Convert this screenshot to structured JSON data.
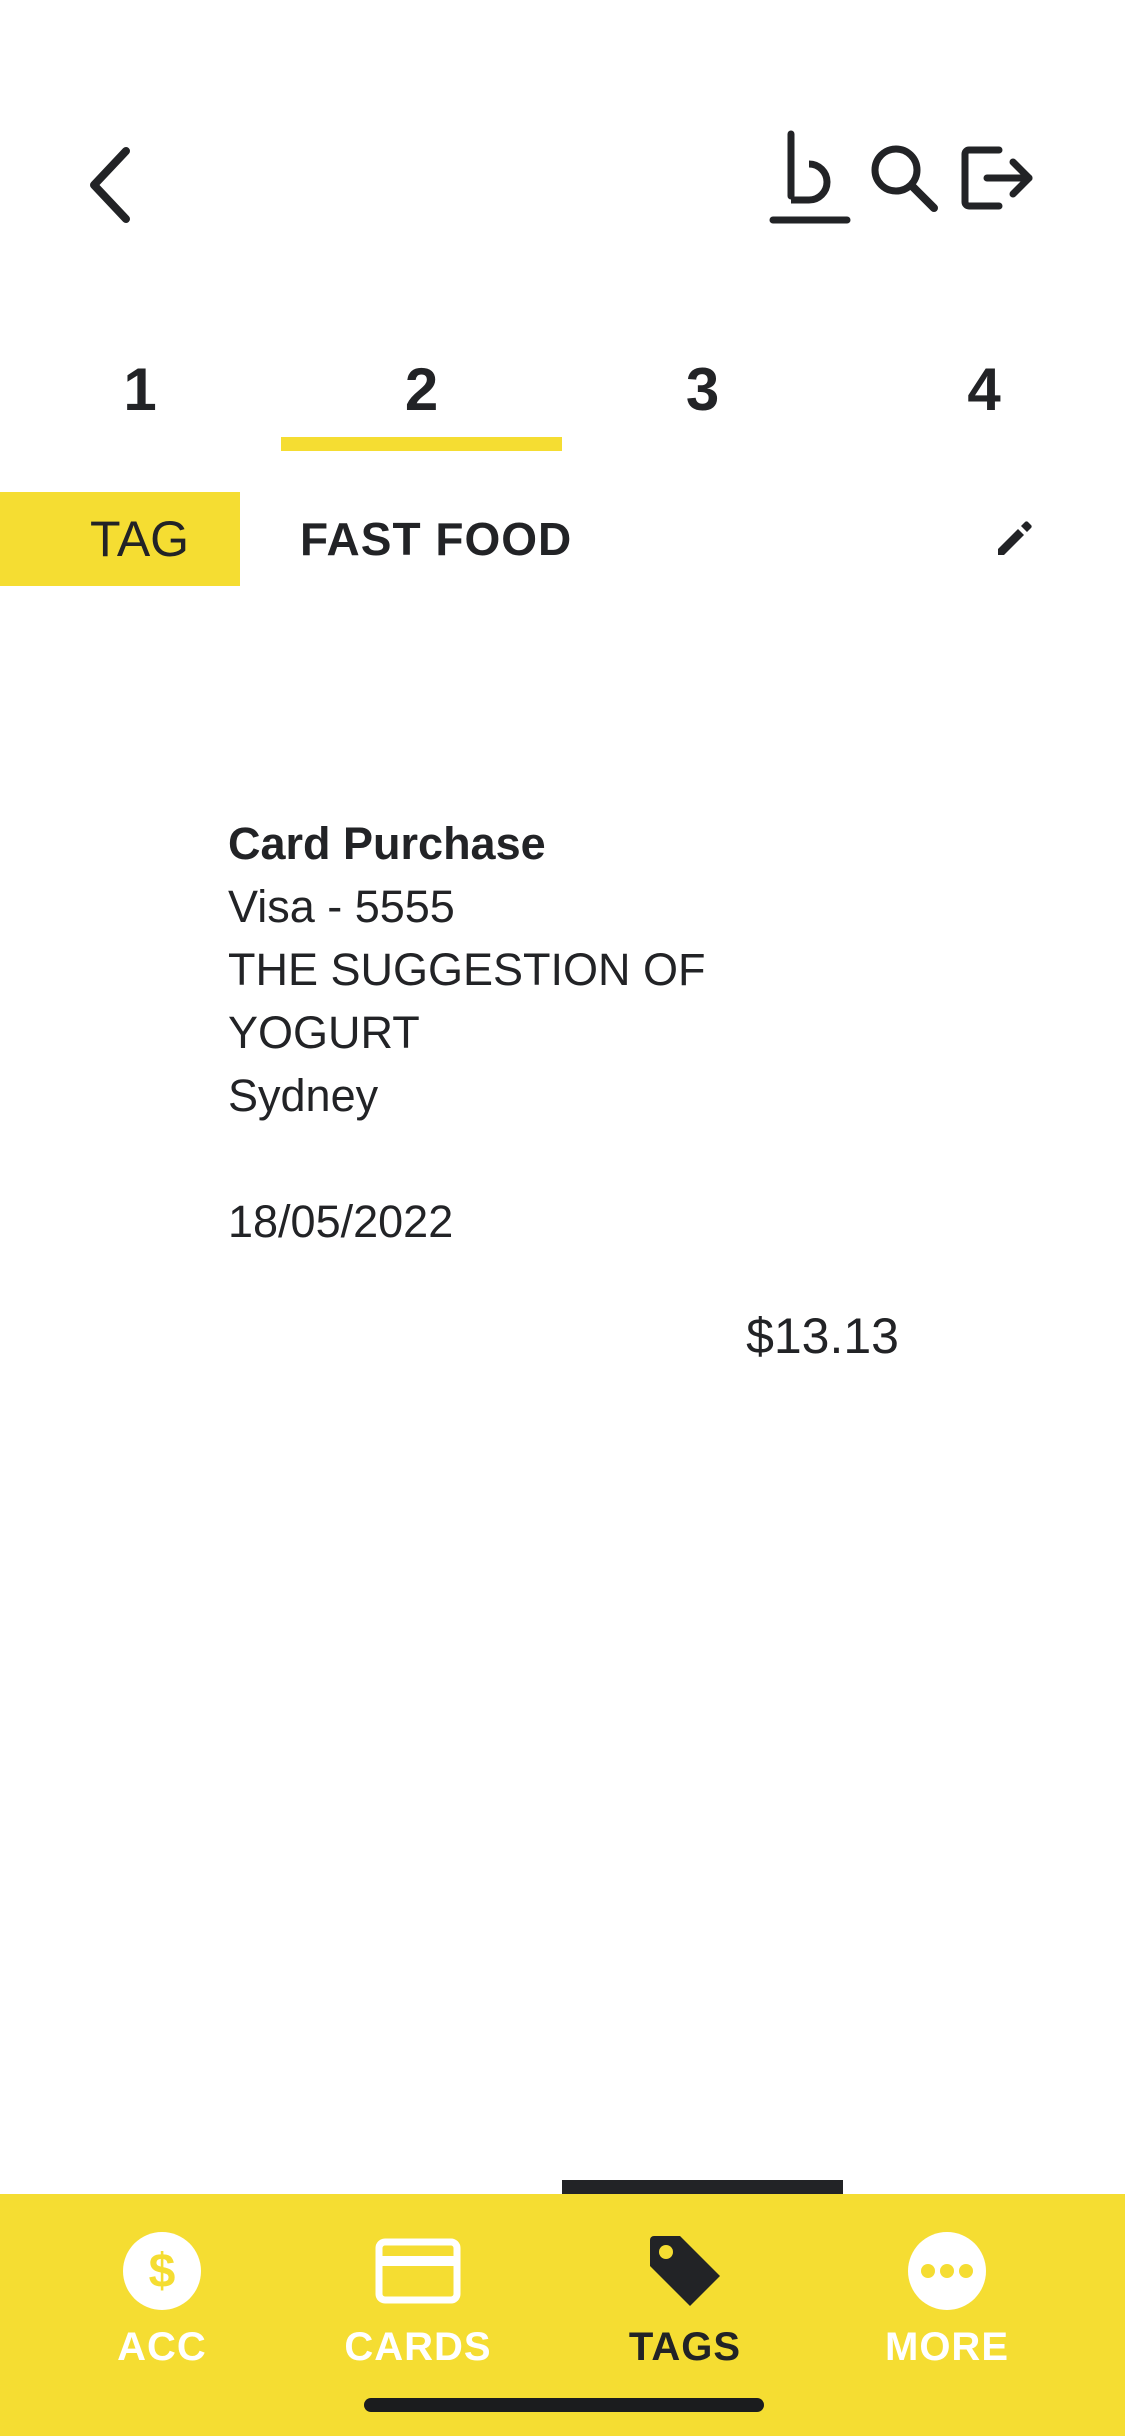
{
  "header": {
    "back_icon": "chevron-left-icon",
    "icons": [
      "bank-logo-icon",
      "search-icon",
      "logout-icon"
    ]
  },
  "pager": {
    "tabs": [
      {
        "label": "1",
        "active": false
      },
      {
        "label": "2",
        "active": true
      },
      {
        "label": "3",
        "active": false
      },
      {
        "label": "4",
        "active": false
      }
    ]
  },
  "tag": {
    "pill_label": "TAG",
    "name": "FAST FOOD",
    "edit_icon": "pencil-icon"
  },
  "transaction": {
    "title": "Card Purchase",
    "card": "Visa - 5555",
    "merchant_line1": "THE SUGGESTION OF",
    "merchant_line2": "YOGURT",
    "location": "Sydney",
    "date": "18/05/2022",
    "amount": "$13.13"
  },
  "bottom_nav": {
    "items": [
      {
        "label": "ACC",
        "icon": "dollar-icon",
        "active": false
      },
      {
        "label": "CARDS",
        "icon": "card-icon",
        "active": false
      },
      {
        "label": "TAGS",
        "icon": "tag-icon",
        "active": true
      },
      {
        "label": "MORE",
        "icon": "more-icon",
        "active": false
      }
    ]
  },
  "colors": {
    "accent": "#f5dd32",
    "text": "#222326",
    "background": "#ffffff"
  }
}
